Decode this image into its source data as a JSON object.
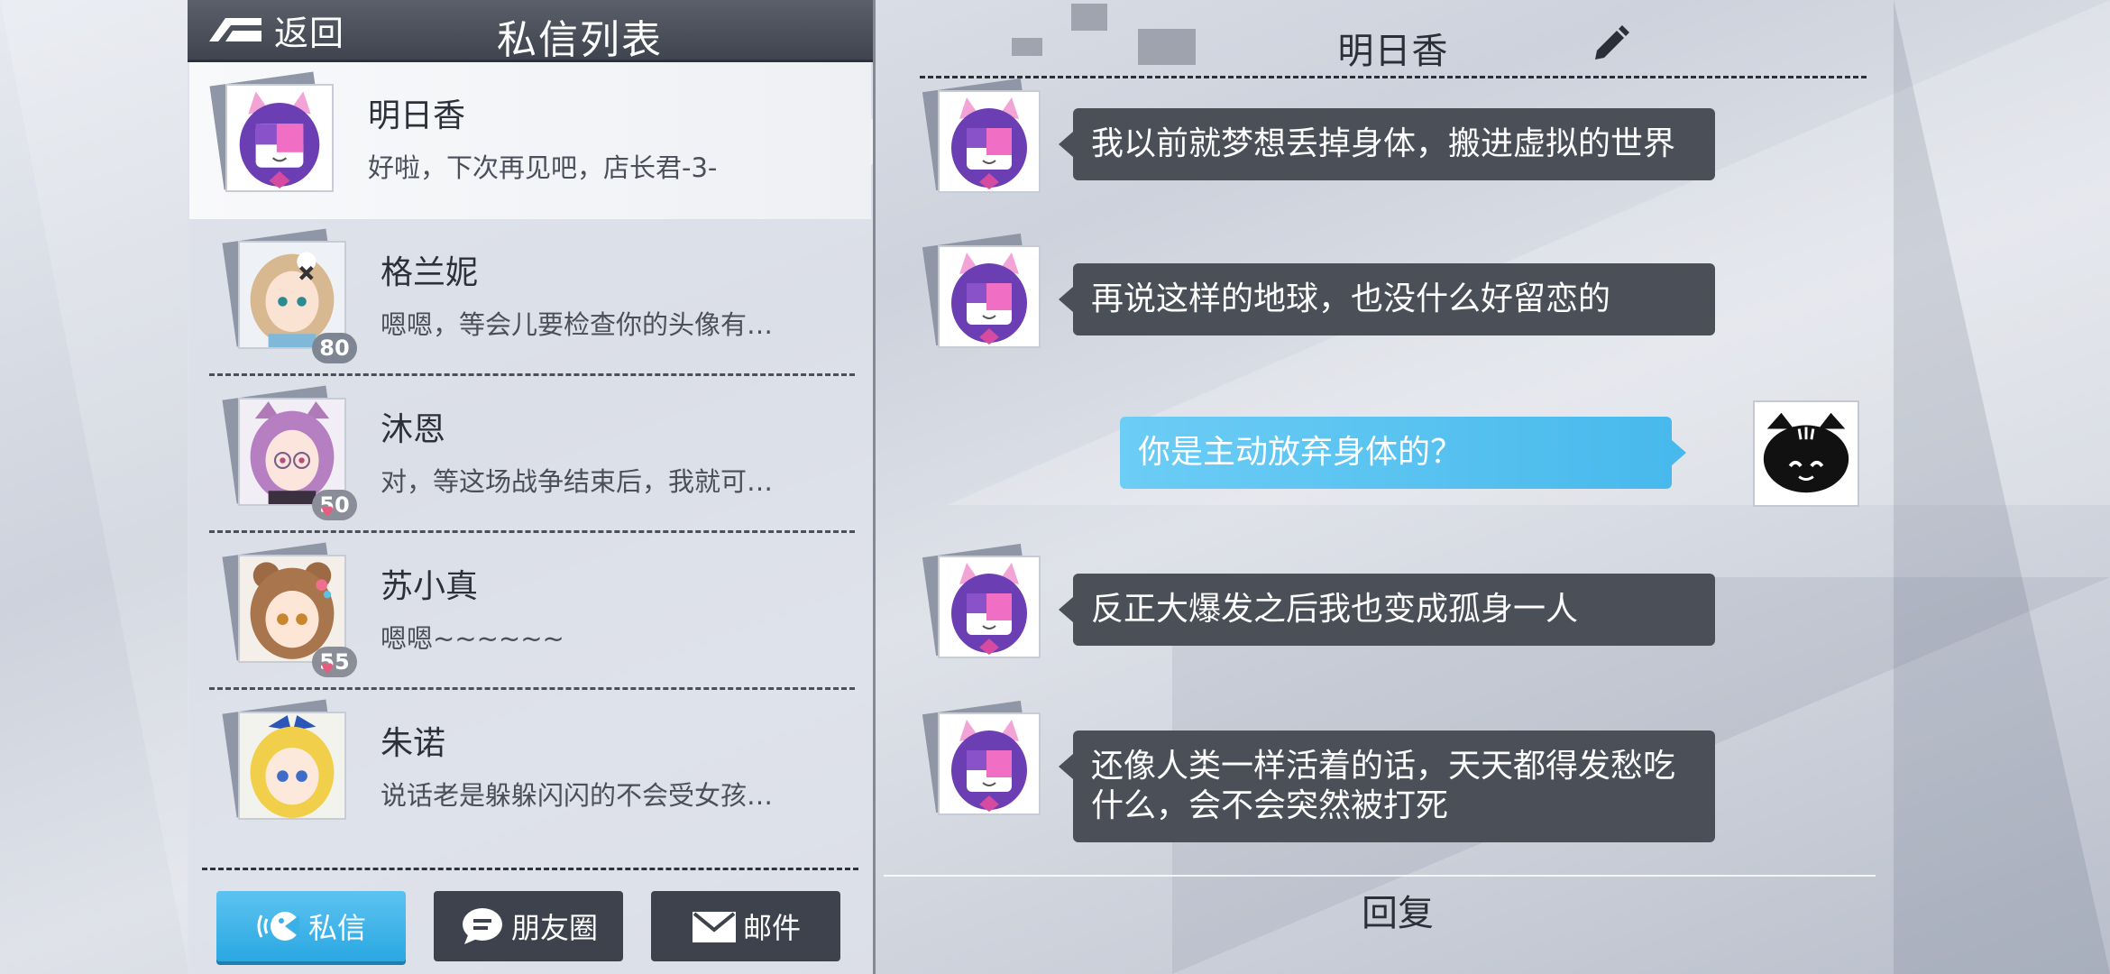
{
  "header": {
    "back_label": "返回",
    "title": "私信列表"
  },
  "conversations": [
    {
      "name": "明日香",
      "preview": "好啦，下次再见吧，店长君-3-",
      "level": "",
      "active": true
    },
    {
      "name": "格兰妮",
      "preview": "嗯嗯，等会儿要检查你的头像有…",
      "level": "80"
    },
    {
      "name": "沐恩",
      "preview": "对，等这场战争结束后，我就可…",
      "level": "50"
    },
    {
      "name": "苏小真",
      "preview": "嗯嗯~~~~~~",
      "level": "55"
    },
    {
      "name": "朱诺",
      "preview": "说话老是躲躲闪闪的不会受女孩…",
      "level": ""
    }
  ],
  "tabs": {
    "private": "私信",
    "moments": "朋友圈",
    "mail": "邮件"
  },
  "chat": {
    "title": "明日香",
    "messages": [
      {
        "from": "other",
        "text": "我以前就梦想丢掉身体，搬进虚拟的世界"
      },
      {
        "from": "other",
        "text": "再说这样的地球，也没什么好留恋的"
      },
      {
        "from": "me",
        "text": "你是主动放弃身体的？"
      },
      {
        "from": "other",
        "text": "反正大爆发之后我也变成孤身一人"
      },
      {
        "from": "other",
        "text": "还像人类一样活着的话，天天都得发愁吃什么，会不会突然被打死"
      }
    ],
    "reply_label": "回复"
  },
  "icons": {
    "back": "back-arrow-icon",
    "edit": "pencil-icon",
    "private": "chat-bubble-icon",
    "moments": "speech-icon",
    "mail": "envelope-icon"
  },
  "colors": {
    "accent": "#2aa7e2",
    "bubble_other": "#4b4f58",
    "bubble_me": "#48b9ec",
    "header": "#3f444e"
  }
}
